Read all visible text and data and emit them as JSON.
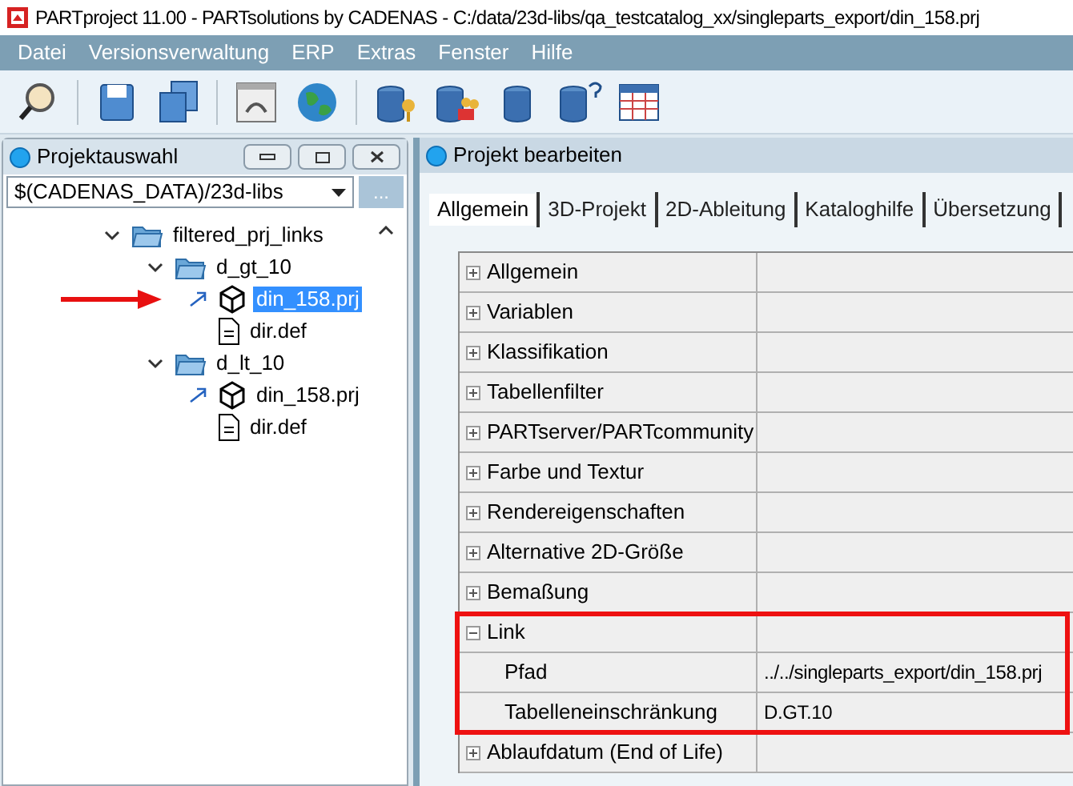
{
  "window": {
    "title": "PARTproject 11.00 - PARTsolutions by CADENAS - C:/data/23d-libs/qa_testcatalog_xx/singleparts_export/din_158.prj"
  },
  "menu": [
    "Datei",
    "Versionsverwaltung",
    "ERP",
    "Extras",
    "Fenster",
    "Hilfe"
  ],
  "left_panel": {
    "title": "Projektauswahl",
    "path": "$(CADENAS_DATA)/23d-libs",
    "browse_button": "...",
    "tree": [
      {
        "label": "filtered_prj_links",
        "kind": "folder",
        "expanded": true,
        "selected": false,
        "children": [
          {
            "label": "d_gt_10",
            "kind": "folder",
            "expanded": true,
            "selected": false,
            "children": [
              {
                "label": "din_158.prj",
                "kind": "project",
                "link": true,
                "selected": true,
                "pointer": true
              },
              {
                "label": "dir.def",
                "kind": "file",
                "link": false,
                "selected": false
              }
            ]
          },
          {
            "label": "d_lt_10",
            "kind": "folder",
            "expanded": true,
            "selected": false,
            "children": [
              {
                "label": "din_158.prj",
                "kind": "project",
                "link": true,
                "selected": false
              },
              {
                "label": "dir.def",
                "kind": "file",
                "link": false,
                "selected": false
              }
            ]
          }
        ]
      }
    ]
  },
  "right_panel": {
    "title": "Projekt bearbeiten",
    "tabs": [
      {
        "label": "Allgemein",
        "selected": true
      },
      {
        "label": "3D-Projekt",
        "selected": false
      },
      {
        "label": "2D-Ableitung",
        "selected": false
      },
      {
        "label": "Kataloghilfe",
        "selected": false
      },
      {
        "label": "Übersetzung",
        "selected": false
      }
    ],
    "properties": [
      {
        "label": "Allgemein",
        "expanded": false,
        "highlighted": false
      },
      {
        "label": "Variablen",
        "expanded": false,
        "highlighted": false
      },
      {
        "label": "Klassifikation",
        "expanded": false,
        "highlighted": false
      },
      {
        "label": "Tabellenfilter",
        "expanded": false,
        "highlighted": false
      },
      {
        "label": "PARTserver/PARTcommunity",
        "expanded": false,
        "highlighted": false
      },
      {
        "label": "Farbe und Textur",
        "expanded": false,
        "highlighted": false
      },
      {
        "label": "Rendereigenschaften",
        "expanded": false,
        "highlighted": false
      },
      {
        "label": "Alternative 2D-Größe",
        "expanded": false,
        "highlighted": false
      },
      {
        "label": "Bemaßung",
        "expanded": false,
        "highlighted": false
      },
      {
        "label": "Link",
        "expanded": true,
        "highlighted": true,
        "children": [
          {
            "label": "Pfad",
            "value": "../../singleparts_export/din_158.prj"
          },
          {
            "label": "Tabelleneinschränkung",
            "value": "D.GT.10"
          }
        ]
      },
      {
        "label": "Ablaufdatum (End of Life)",
        "expanded": false,
        "highlighted": false
      }
    ]
  }
}
